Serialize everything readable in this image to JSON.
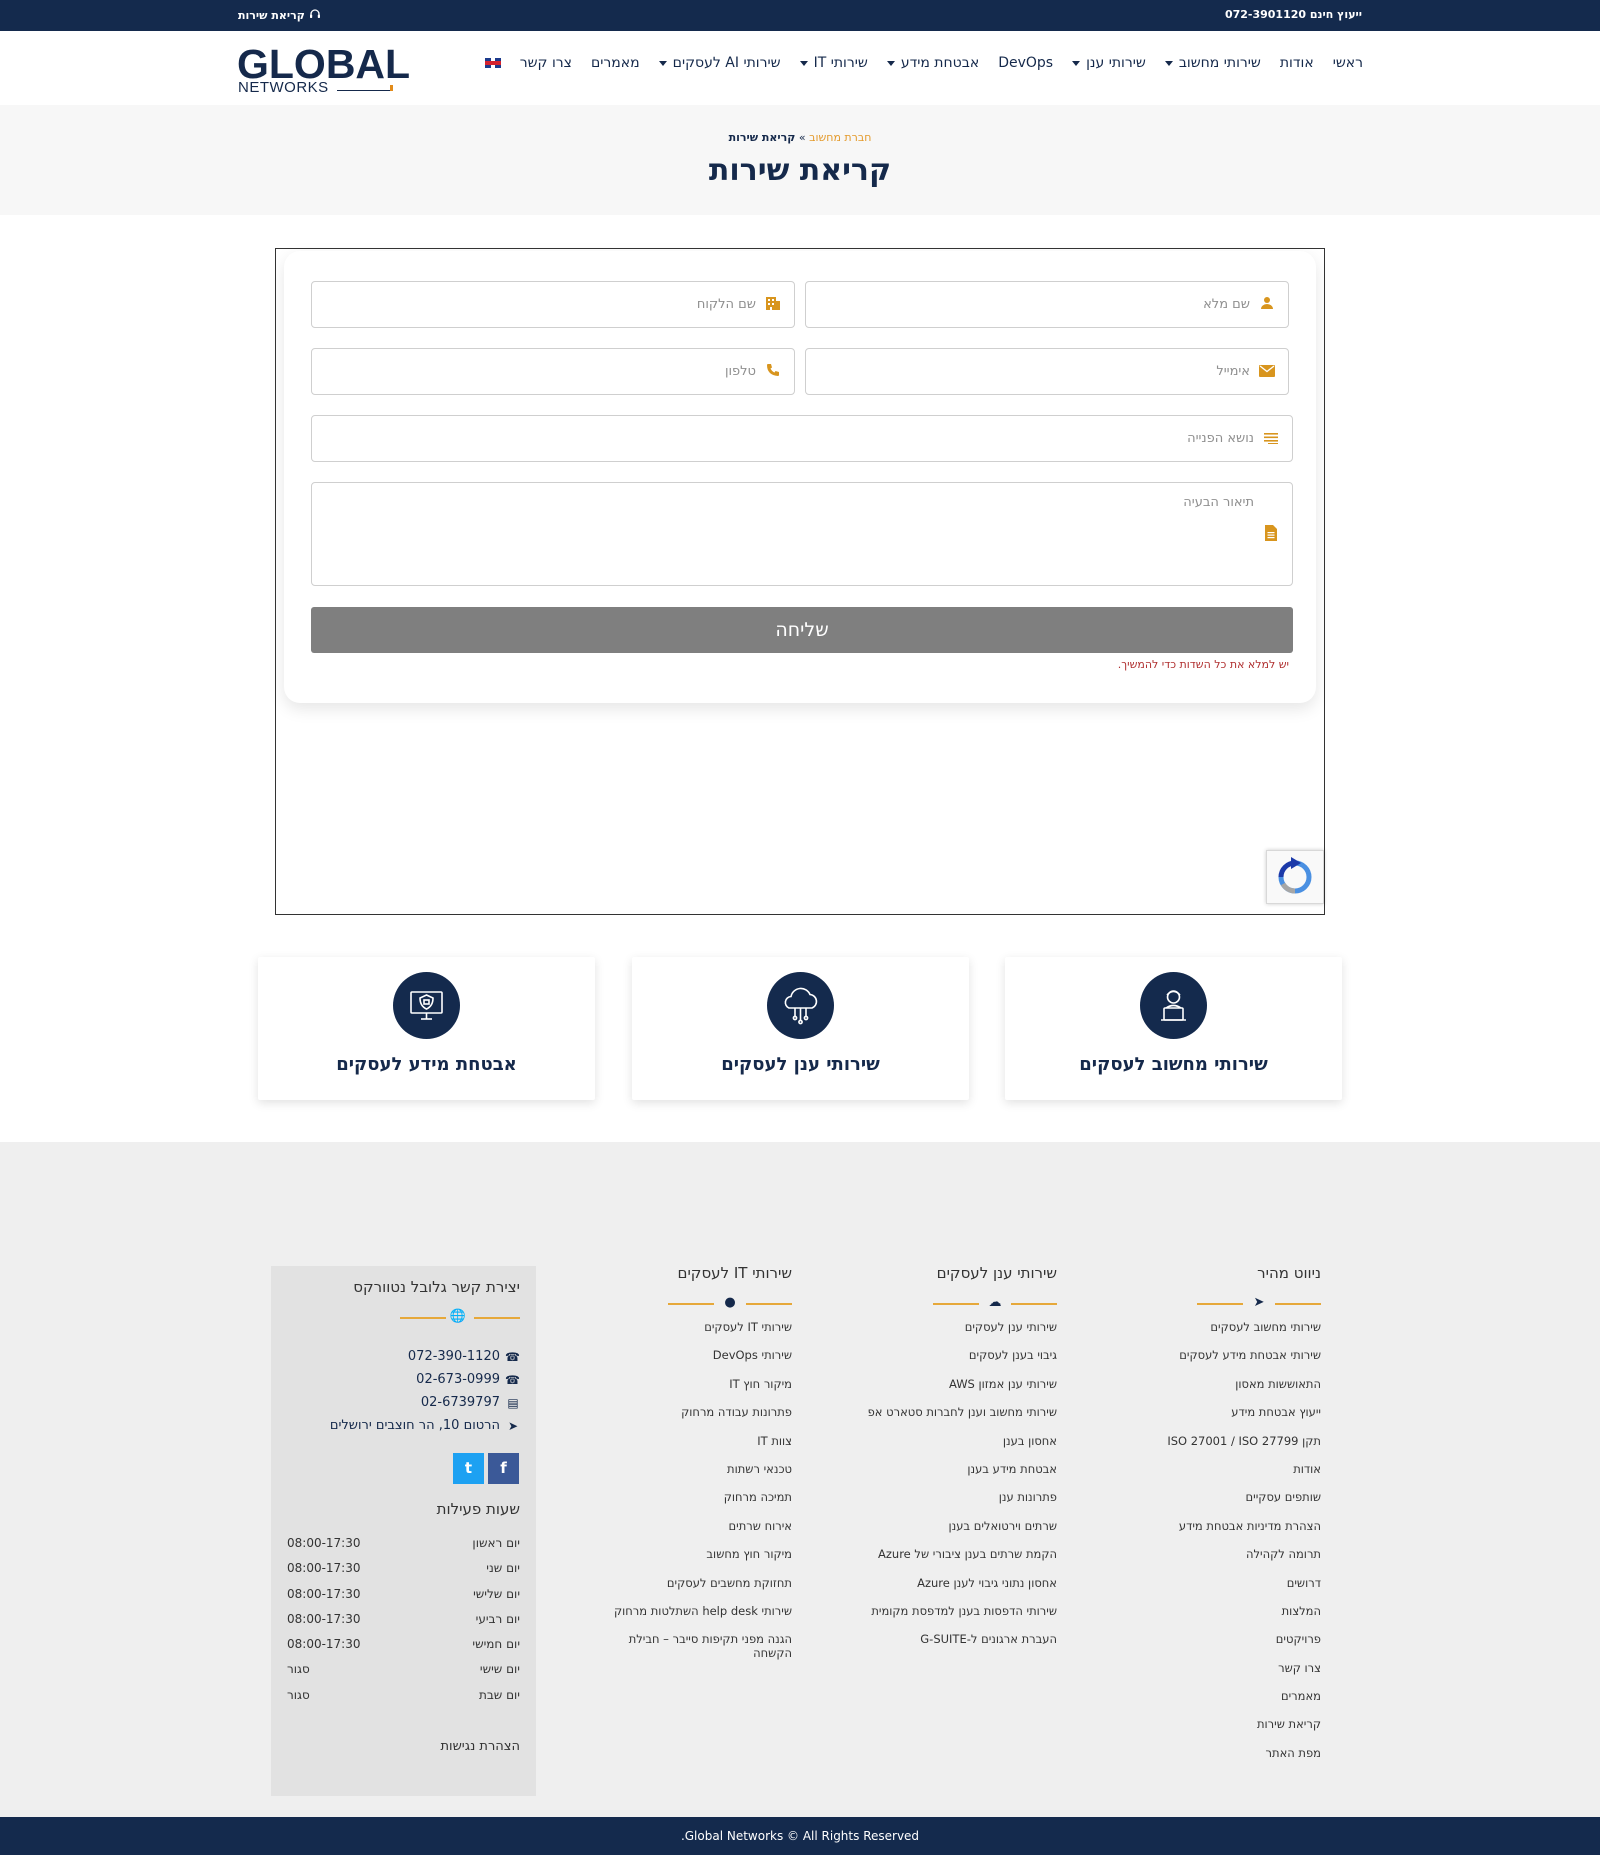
{
  "topbar": {
    "consult": "ייעוץ חינם 072-3901120",
    "service_call": "קריאת שירות"
  },
  "logo": {
    "big": "GLOBAL",
    "small": "NETWORKS"
  },
  "nav": {
    "items": [
      "ראשי",
      "אודות",
      "שירותי מחשוב",
      "שירותי ענן",
      "DevOps",
      "אבטחת מידע",
      "שירותי IT",
      "שירותי AI לעסקים",
      "מאמרים",
      "צרו קשר"
    ]
  },
  "hero": {
    "breadcrumb_home": "חברת מחשוב",
    "breadcrumb_sep": "»",
    "breadcrumb_current": "קריאת שירות",
    "title": "קריאת שירות"
  },
  "form": {
    "full_name_ph": "שם מלא",
    "client_name_ph": "שם הלקוח",
    "email_ph": "אימייל",
    "phone_ph": "טלפון",
    "subject_ph": "נושא הפנייה",
    "problem_ph": "תיאור הבעיה",
    "submit": "שליחה",
    "error": "יש למלא את כל השדות כדי להמשיך."
  },
  "services": [
    {
      "title": "שירותי מחשוב לעסקים",
      "icon": "technician-icon"
    },
    {
      "title": "שירותי ענן לעסקים",
      "icon": "cloud-icon"
    },
    {
      "title": "אבטחת מידע לעסקים",
      "icon": "security-monitor-icon"
    }
  ],
  "footer": {
    "nav_title": "ניווט מהיר",
    "nav_links": [
      "שירותי מחשוב לעסקים",
      "שירותי אבטחת מידע לעסקים",
      "התאוששות מאסון",
      "ייעוץ אבטחת מידע",
      "תקן ISO 27001 / ISO 27799",
      "אודות",
      "שותפים עסקיים",
      "הצהרת מדיניות אבטחת מידע",
      "תרומה לקהילה",
      "דרושים",
      "המלצות",
      "פרויקטים",
      "צרו קשר",
      "מאמרים",
      "קריאת שירות",
      "מפת האתר"
    ],
    "cloud_title": "שירותי ענן לעסקים",
    "cloud_links": [
      "שירותי ענן לעסקים",
      "גיבוי בענן לעסקים",
      "שירותי ענן אמזון AWS",
      "שירותי מחשוב וענן לחברות סטארט אפ",
      "אחסון בענן",
      "אבטחת מידע בענן",
      "פתרונות ענן",
      "שרתים וירטואלים בענן",
      "הקמת שרתים בענן ציבורי של Azure",
      "אחסון נתוני גיבוי לענן Azure",
      "שירותי הדפסות בענן למדפסת מקומית",
      "העברת ארגונים ל-G-SUITE"
    ],
    "it_title": "שירותי IT לעסקים",
    "it_links": [
      "שירותי IT לעסקים",
      "שירותי DevOps",
      "מיקור חוץ IT",
      "פתרונות עבודה מרחוק",
      "צוות IT",
      "טכנאי רשתות",
      "תמיכה מרחוק",
      "אירוח שרתים",
      "מיקור חוץ מחשוב",
      "תחזוקת מחשבים לעסקים",
      "שירותי help desk השתלטות מרחוק",
      "הגנה מפני תקיפות סייבר – חבילת הקשחה"
    ],
    "contact_title": "יצירת קשר גלובל נטוורקס",
    "phone1": "072-390-1120",
    "phone2": "02-673-0999",
    "fax": "02-6739797",
    "address": "הרטום 10, הר חוצבים ירושלים",
    "hours_title": "שעות פעילות",
    "hours": [
      {
        "day": "יום ראשון",
        "time": "08:00-17:30"
      },
      {
        "day": "יום שני",
        "time": "08:00-17:30"
      },
      {
        "day": "יום שלישי",
        "time": "08:00-17:30"
      },
      {
        "day": "יום רביעי",
        "time": "08:00-17:30"
      },
      {
        "day": "יום חמישי",
        "time": "08:00-17:30"
      },
      {
        "day": "יום שישי",
        "time": "סגור"
      },
      {
        "day": "יום שבת",
        "time": "סגור"
      }
    ],
    "accessibility": "הצהרת נגישות",
    "copyright": ".Global Networks © All Rights Reserved"
  },
  "colors": {
    "navy": "#142a4d",
    "accent": "#e49a2b",
    "button": "#7f7f7f",
    "footer_bg": "#efefef"
  }
}
